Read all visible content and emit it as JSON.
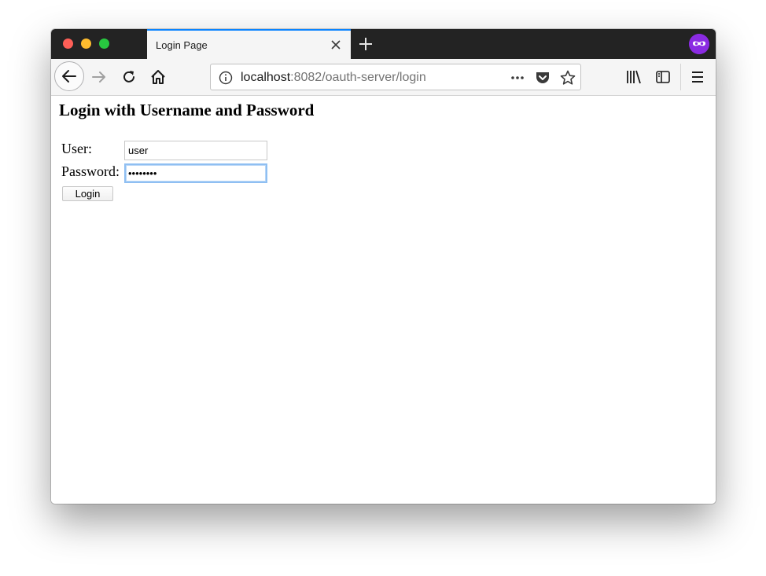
{
  "browser": {
    "tab": {
      "title": "Login Page"
    },
    "url": {
      "host": "localhost",
      "rest": ":8082/oauth-server/login"
    }
  },
  "page": {
    "heading": "Login with Username and Password",
    "form": {
      "user_label": "User:",
      "user_value": "user",
      "password_label": "Password:",
      "password_mask": "••••••••",
      "submit_label": "Login"
    }
  },
  "colors": {
    "tab_accent": "#0a84ff",
    "private_badge": "#8a2be2",
    "focus_ring": "#8fbff2"
  },
  "icons": [
    "back-arrow-icon",
    "forward-arrow-icon",
    "reload-icon",
    "home-icon",
    "info-icon",
    "more-icon",
    "pocket-icon",
    "star-icon",
    "library-icon",
    "sidebar-icon",
    "menu-icon",
    "close-icon",
    "plus-icon",
    "private-browsing-icon"
  ]
}
